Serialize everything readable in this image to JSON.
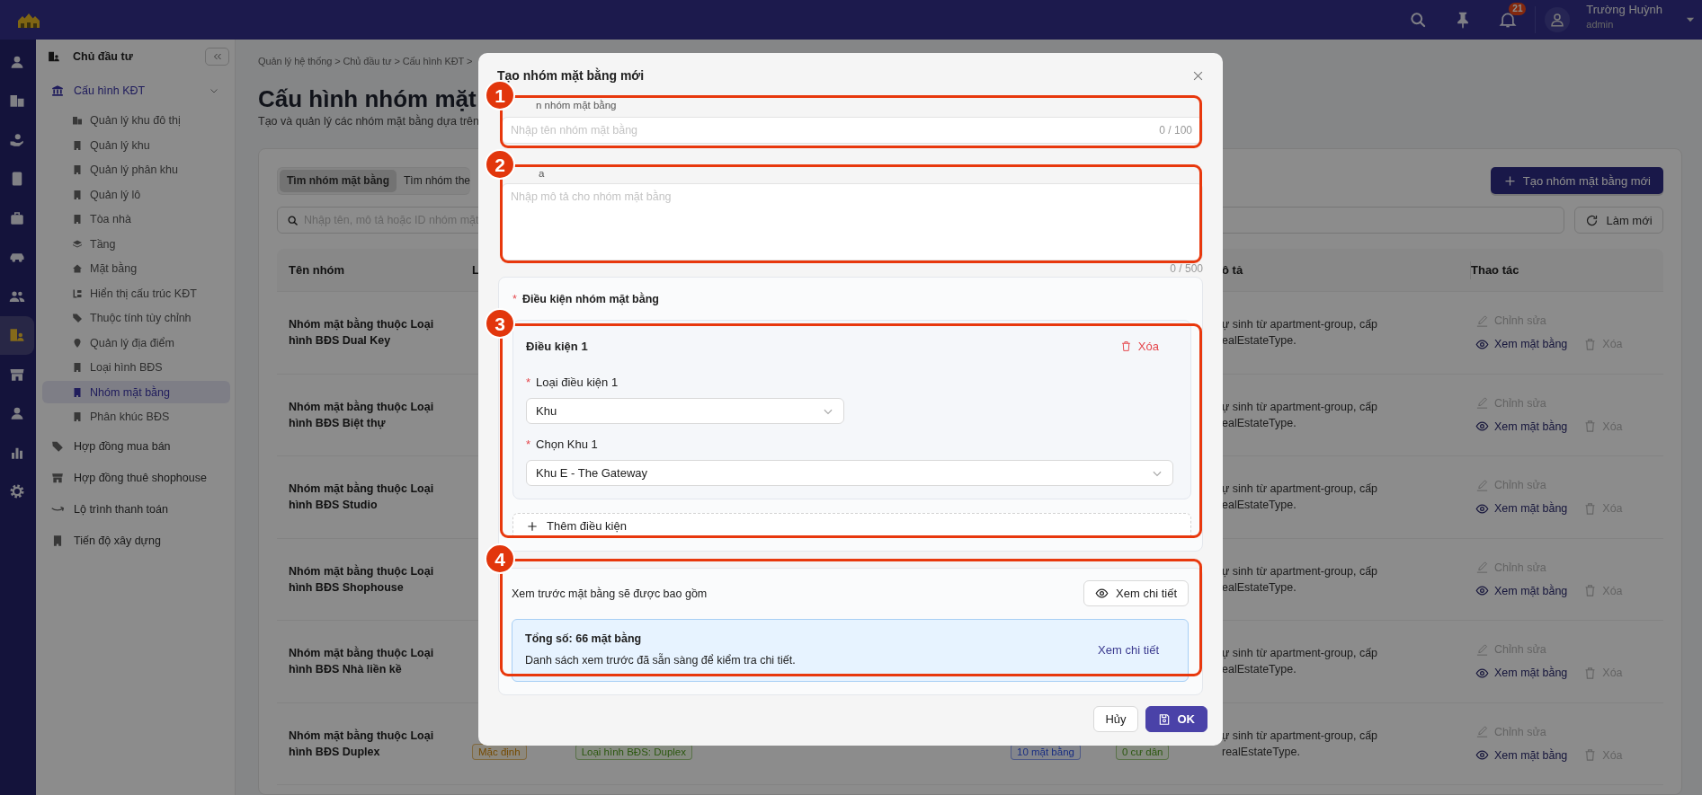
{
  "top_bar": {
    "notification_count": "21",
    "user_name": "Trường Huỳnh",
    "user_role": "admin"
  },
  "rail": [
    {
      "selected": false
    },
    {
      "selected": false
    },
    {
      "selected": false
    },
    {
      "selected": false
    },
    {
      "selected": false
    },
    {
      "selected": false
    },
    {
      "selected": false
    },
    {
      "selected": true
    },
    {
      "selected": false
    },
    {
      "selected": false
    },
    {
      "selected": false
    },
    {
      "selected": false
    }
  ],
  "sidebar": {
    "header": "Chủ đầu tư",
    "items": [
      {
        "label": "Cấu hình KĐT",
        "selected": true,
        "expanded": true,
        "children": [
          {
            "label": "Quản lý khu đô thị",
            "selected": false
          },
          {
            "label": "Quản lý khu",
            "selected": false
          },
          {
            "label": "Quản lý phân khu",
            "selected": false
          },
          {
            "label": "Quản lý lô",
            "selected": false
          },
          {
            "label": "Tòa nhà",
            "selected": false
          },
          {
            "label": "Tầng",
            "selected": false
          },
          {
            "label": "Mặt bằng",
            "selected": false
          },
          {
            "label": "Hiển thị cấu trúc KĐT",
            "selected": false
          },
          {
            "label": "Thuộc tính tùy chỉnh",
            "selected": false
          },
          {
            "label": "Quản lý địa điểm",
            "selected": false
          },
          {
            "label": "Loại hình BĐS",
            "selected": false
          },
          {
            "label": "Nhóm mặt bằng",
            "selected": true
          },
          {
            "label": "Phân khúc BĐS",
            "selected": false
          }
        ]
      },
      {
        "label": "Hợp đồng mua bán",
        "selected": false
      },
      {
        "label": "Hợp đồng thuê shophouse",
        "selected": false
      },
      {
        "label": "Lộ trình thanh toán",
        "selected": false
      },
      {
        "label": "Tiến độ xây dựng",
        "selected": false
      }
    ]
  },
  "breadcrumb": "Quản lý hệ thống > Chủ đầu tư > Cấu hình KĐT >",
  "page": {
    "title": "Cấu hình nhóm mặt",
    "subtitle": "Tạo và quản lý các nhóm mặt bằng dựa trên"
  },
  "tabs": [
    {
      "label": "Tìm nhóm mặt bằng",
      "selected": true
    },
    {
      "label": "Tìm nhóm the",
      "selected": false
    }
  ],
  "create_button": "Tạo nhóm mặt bằng mới",
  "search": {
    "placeholder": "Nhập tên, mô tả hoặc ID nhóm mặt"
  },
  "refresh_button": "Làm mới",
  "table": {
    "columns": [
      "Tên nhóm",
      "L",
      "ô tả",
      "Thao tác"
    ],
    "rows": [
      {
        "name": "Nhóm mặt bằng thuộc Loại hình BĐS Dual Key",
        "description": [
          "ự sinh từ apartment-group, cấp",
          "ealEstateType."
        ],
        "actions": [
          {
            "label": "Chỉnh sửa",
            "kind": "edit",
            "disabled": true
          },
          {
            "label": "Xem mặt bằng",
            "kind": "view",
            "disabled": false
          },
          {
            "label": "Xóa",
            "kind": "delete",
            "disabled": true
          }
        ]
      },
      {
        "name": "Nhóm mặt bằng thuộc Loại hình BĐS Biệt thự",
        "description": [
          "ự sinh từ apartment-group, cấp",
          "ealEstateType."
        ],
        "actions": [
          {
            "label": "Chỉnh sửa",
            "kind": "edit",
            "disabled": true
          },
          {
            "label": "Xem mặt bằng",
            "kind": "view",
            "disabled": false
          },
          {
            "label": "Xóa",
            "kind": "delete",
            "disabled": true
          }
        ]
      },
      {
        "name": "Nhóm mặt bằng thuộc Loại hình BĐS Studio",
        "description": [
          "ự sinh từ apartment-group, cấp",
          "ealEstateType."
        ],
        "actions": [
          {
            "label": "Chỉnh sửa",
            "kind": "edit",
            "disabled": true
          },
          {
            "label": "Xem mặt bằng",
            "kind": "view",
            "disabled": false
          },
          {
            "label": "Xóa",
            "kind": "delete",
            "disabled": true
          }
        ]
      },
      {
        "name": "Nhóm mặt bằng thuộc Loại hình BĐS Shophouse",
        "description": [
          "ự sinh từ apartment-group, cấp",
          "ealEstateType."
        ],
        "actions": [
          {
            "label": "Chỉnh sửa",
            "kind": "edit",
            "disabled": true
          },
          {
            "label": "Xem mặt bằng",
            "kind": "view",
            "disabled": false
          },
          {
            "label": "Xóa",
            "kind": "delete",
            "disabled": true
          }
        ]
      },
      {
        "name": "Nhóm mặt bằng thuộc Loại hình BĐS Nhà liền kề",
        "description": [
          "ự sinh từ apartment-group, cấp",
          "ealEstateType."
        ],
        "actions": [
          {
            "label": "Chỉnh sửa",
            "kind": "edit",
            "disabled": true
          },
          {
            "label": "Xem mặt bằng",
            "kind": "view",
            "disabled": false
          },
          {
            "label": "Xóa",
            "kind": "delete",
            "disabled": true
          }
        ]
      },
      {
        "name": "Nhóm mặt bằng thuộc Loại hình BĐS Duplex",
        "status": "Mặc định",
        "type": "Loại hình BĐS: Duplex",
        "units": "10 mặt bằng",
        "residents": "0 cư dân",
        "description": [
          "ự sinh từ apartment-group, cấp",
          "realEstateType."
        ],
        "actions": [
          {
            "label": "Chỉnh sửa",
            "kind": "edit",
            "disabled": true
          },
          {
            "label": "Xem mặt bằng",
            "kind": "view",
            "disabled": false
          },
          {
            "label": "Xóa",
            "kind": "delete",
            "disabled": true
          }
        ]
      }
    ]
  },
  "modal": {
    "title": "Tạo nhóm mặt bằng mới",
    "fields": [
      {
        "kind": "input",
        "label": "n nhóm mặt bằng",
        "placeholder": "Nhập tên nhóm mặt bằng",
        "counter": "0 / 100"
      },
      {
        "kind": "textarea",
        "label": "a",
        "placeholder": "Nhập mô tả cho nhóm mặt bằng",
        "counter": "0 / 500"
      }
    ],
    "conditions": {
      "required_mark": "*",
      "title": "Điều kiện nhóm mặt bằng",
      "add_button": "Thêm điều kiện",
      "items": [
        {
          "title": "Điều kiện 1",
          "delete": "Xóa",
          "fields": [
            {
              "required_mark": "*",
              "label": "Loại điều kiện 1",
              "value": "Khu",
              "kind": "short"
            },
            {
              "required_mark": "*",
              "label": "Chọn Khu 1",
              "value": "Khu E - The Gateway",
              "kind": "wide"
            }
          ]
        }
      ]
    },
    "preview": {
      "text": "Xem trước mặt bằng sẽ được bao gồm",
      "button": "Xem chi tiết",
      "summary_title": "Tổng số: 66 mặt bằng",
      "summary_text": "Danh sách xem trước đã sẵn sàng để kiểm tra chi tiết.",
      "summary_link": "Xem chi tiết"
    },
    "buttons": [
      {
        "label": "Hủy",
        "kind": "default"
      },
      {
        "label": "OK",
        "kind": "primary"
      }
    ]
  },
  "annotations": [
    {
      "number": "1"
    },
    {
      "number": "2"
    },
    {
      "number": "3"
    },
    {
      "number": "4"
    }
  ]
}
